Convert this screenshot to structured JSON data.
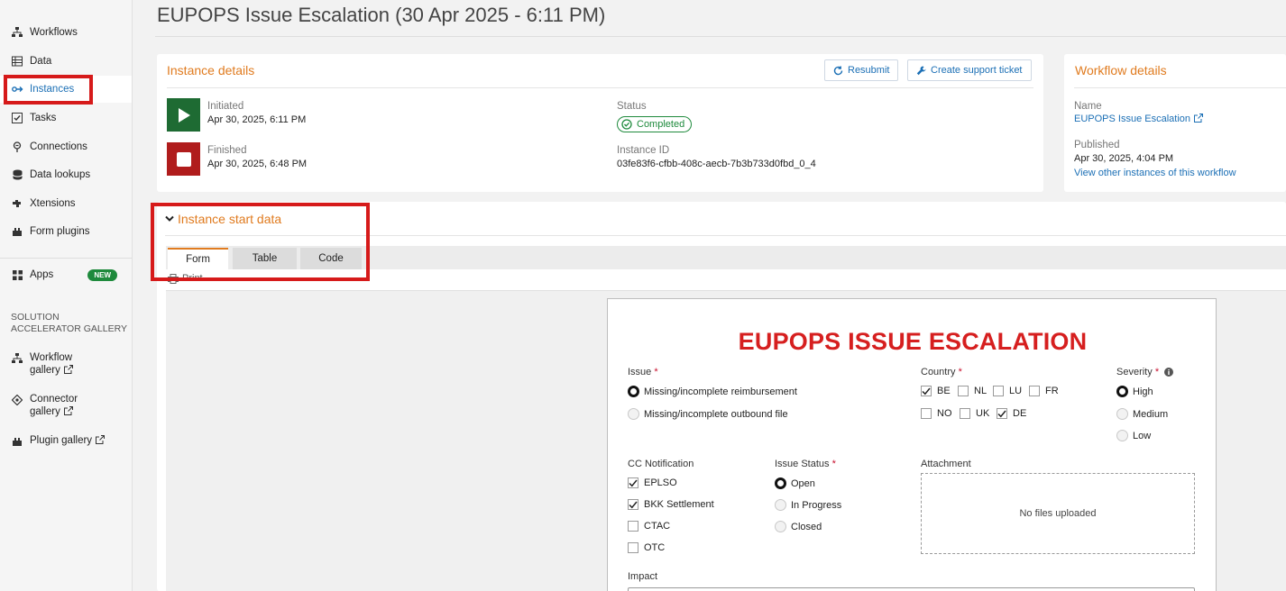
{
  "sidebar": {
    "items": [
      {
        "label": "Workflows",
        "icon": "workflows-icon"
      },
      {
        "label": "Data",
        "icon": "data-icon"
      },
      {
        "label": "Instances",
        "icon": "instances-icon"
      },
      {
        "label": "Tasks",
        "icon": "tasks-icon"
      },
      {
        "label": "Connections",
        "icon": "connections-icon"
      },
      {
        "label": "Data lookups",
        "icon": "data-lookups-icon"
      },
      {
        "label": "Xtensions",
        "icon": "xtensions-icon"
      },
      {
        "label": "Form plugins",
        "icon": "form-plugins-icon"
      }
    ],
    "apps": {
      "label": "Apps",
      "badge": "NEW"
    },
    "gallery_heading_1": "SOLUTION",
    "gallery_heading_2": "ACCELERATOR GALLERY",
    "gallery": [
      {
        "line1": "Workflow",
        "line2": "gallery"
      },
      {
        "line1": "Connector",
        "line2": "gallery"
      },
      {
        "line1": "Plugin gallery",
        "line2": ""
      }
    ],
    "active": "Instances"
  },
  "page": {
    "title": "EUPOPS Issue Escalation (30 Apr 2025 - 6:11 PM)"
  },
  "instance_details": {
    "title": "Instance details",
    "resubmit_label": "Resubmit",
    "support_label": "Create support ticket",
    "initiated_label": "Initiated",
    "initiated_value": "Apr 30, 2025, 6:11 PM",
    "finished_label": "Finished",
    "finished_value": "Apr 30, 2025, 6:48 PM",
    "status_label": "Status",
    "status_value": "Completed",
    "instance_id_label": "Instance ID",
    "instance_id_value": "03fe83f6-cfbb-408c-aecb-7b3b733d0fbd_0_4",
    "colors": {
      "initiated": "#1e6b33",
      "finished": "#b01c1c",
      "status": "#1e8a3c"
    }
  },
  "workflow_details": {
    "title": "Workflow details",
    "name_label": "Name",
    "name_value": "EUPOPS Issue Escalation",
    "published_label": "Published",
    "published_value": "Apr 30, 2025, 4:04 PM",
    "other_instances_link": "View other instances of this workflow"
  },
  "start_data": {
    "title": "Instance start data",
    "tabs": [
      "Form",
      "Table",
      "Code"
    ],
    "active_tab": "Form",
    "print_label": "Print"
  },
  "form": {
    "heading": "EUPOPS ISSUE ESCALATION",
    "issue": {
      "label": "Issue",
      "options": [
        {
          "label": "Missing/incomplete reimbursement",
          "selected": true
        },
        {
          "label": "Missing/incomplete outbound file",
          "selected": false
        }
      ]
    },
    "country": {
      "label": "Country",
      "options": [
        {
          "label": "BE",
          "checked": true
        },
        {
          "label": "NL",
          "checked": false
        },
        {
          "label": "LU",
          "checked": false
        },
        {
          "label": "FR",
          "checked": false
        },
        {
          "label": "NO",
          "checked": false
        },
        {
          "label": "UK",
          "checked": false
        },
        {
          "label": "DE",
          "checked": true
        }
      ]
    },
    "severity": {
      "label": "Severity",
      "options": [
        {
          "label": "High",
          "selected": true
        },
        {
          "label": "Medium",
          "selected": false
        },
        {
          "label": "Low",
          "selected": false
        }
      ]
    },
    "cc_notification": {
      "label": "CC Notification",
      "options": [
        {
          "label": "EPLSO",
          "checked": true
        },
        {
          "label": "BKK Settlement",
          "checked": true
        },
        {
          "label": "CTAC",
          "checked": false
        },
        {
          "label": "OTC",
          "checked": false
        }
      ]
    },
    "issue_status": {
      "label": "Issue Status",
      "options": [
        {
          "label": "Open",
          "selected": true
        },
        {
          "label": "In Progress",
          "selected": false
        },
        {
          "label": "Closed",
          "selected": false
        }
      ]
    },
    "attachment": {
      "label": "Attachment",
      "empty_text": "No files uploaded"
    },
    "impact": {
      "label": "Impact"
    },
    "required_mark": "*"
  }
}
